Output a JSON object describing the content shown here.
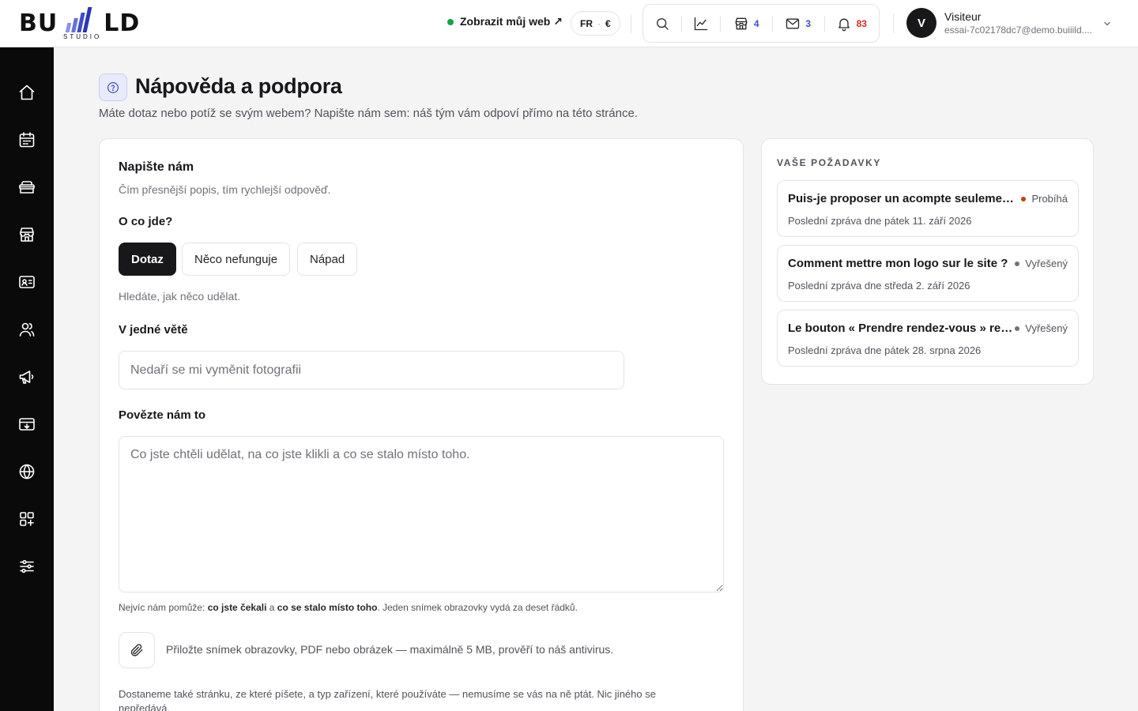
{
  "brand": {
    "logo_left": "BU",
    "logo_right": "LD",
    "logo_sub": "STUDIO",
    "bar_colors": [
      "#8b93e8",
      "#6470de",
      "#3f4bd1",
      "#2a35b8"
    ]
  },
  "header": {
    "view_site": "Zobrazit můj web ↗",
    "lang": "FR",
    "currency": "€",
    "tools": [
      {
        "icon": "search-icon",
        "count": ""
      },
      {
        "icon": "chart-icon",
        "count": ""
      },
      {
        "icon": "store-icon",
        "count": "4",
        "color": "#3f4bd1"
      },
      {
        "icon": "mail-icon",
        "count": "3",
        "color": "#3f4bd1"
      },
      {
        "icon": "bell-icon",
        "count": "83",
        "color": "#dc2626"
      }
    ],
    "user": {
      "initial": "V",
      "name": "Visiteur",
      "email": "essai-7c02178dc7@demo.buiiild...."
    }
  },
  "sidebar": [
    {
      "icon": "home-icon"
    },
    {
      "icon": "calendar-icon"
    },
    {
      "icon": "services-icon"
    },
    {
      "icon": "shop-icon"
    },
    {
      "icon": "contact-card-icon"
    },
    {
      "icon": "users-icon"
    },
    {
      "icon": "megaphone-icon"
    },
    {
      "icon": "payment-icon"
    },
    {
      "icon": "globe-icon"
    },
    {
      "icon": "apps-icon"
    },
    {
      "icon": "settings-sliders-icon"
    }
  ],
  "page": {
    "title": "Nápověda a podpora",
    "subtitle": "Máte dotaz nebo potíž se svým webem? Napište nám sem: náš tým vám odpoví přímo na této stránce."
  },
  "form": {
    "title": "Napište nám",
    "subtitle": "Čím přesnější popis, tím rychlejší odpověď.",
    "type_label": "O co jde?",
    "types": [
      "Dotaz",
      "Něco nefunguje",
      "Nápad"
    ],
    "active_type": "Dotaz",
    "type_hint": "Hledáte, jak něco udělat.",
    "summary_label": "V jedné větě",
    "summary_placeholder": "Nedaří se mi vyměnit fotografii",
    "details_label": "Povězte nám to",
    "details_placeholder": "Co jste chtěli udělat, na co jste klikli a co se stalo místo toho.",
    "help_prefix": "Nejvíc nám pomůže: ",
    "help_bold1": "co jste čekali",
    "help_mid": " a ",
    "help_bold2": "co se stalo místo toho",
    "help_suffix": ". Jeden snímek obrazovky vydá za deset řádků.",
    "attach_text": "Přiložte snímek obrazovky, PDF nebo obrázek — maximálně 5 MB, prověří to náš antivirus.",
    "footer_note": "Dostaneme také stránku, ze které píšete, a typ zařízení, které používáte — nemusíme se vás na ně ptát. Nic jiného se nepředává."
  },
  "requests": {
    "heading": "VAŠE POŽADAVKY",
    "items": [
      {
        "title": "Puis-je proposer un acompte seulement ?",
        "status": "Probíhá",
        "status_color": "#c2410c",
        "date": "Poslední zpráva dne pátek 11. září 2026"
      },
      {
        "title": "Comment mettre mon logo sur le site ?",
        "status": "Vyřešený",
        "status_color": "#71717a",
        "date": "Poslední zpráva dne středa 2. září 2026"
      },
      {
        "title": "Le bouton « Prendre rendez-vous » reste inactif",
        "status": "Vyřešený",
        "status_color": "#71717a",
        "date": "Poslední zpráva dne pátek 28. srpna 2026"
      }
    ]
  }
}
